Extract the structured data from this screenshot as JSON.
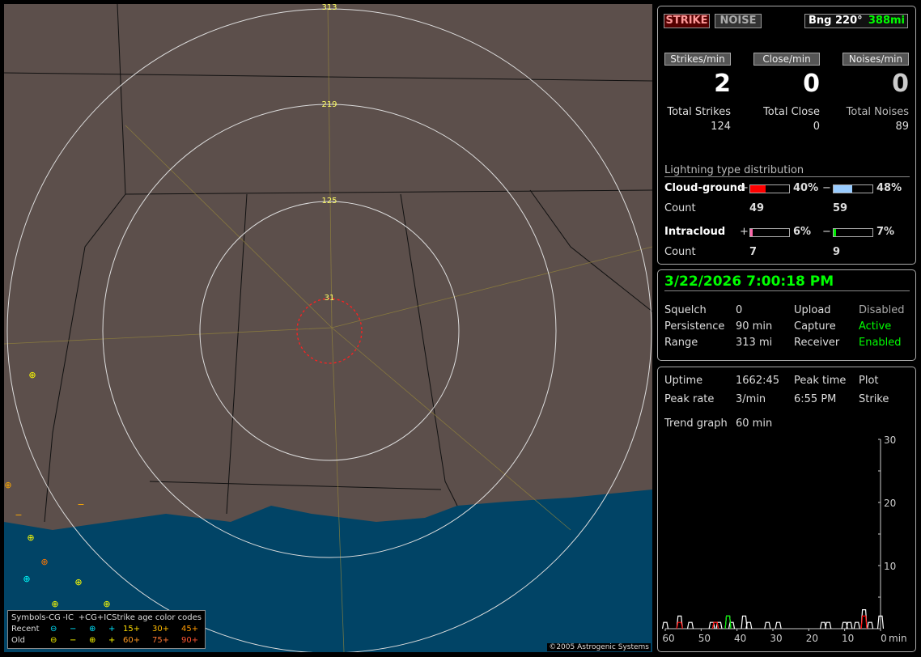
{
  "map": {
    "range_labels": [
      "313",
      "219",
      "125",
      "31"
    ],
    "legend": {
      "header": [
        "Symbols",
        "-CG",
        "-IC",
        "+CG",
        "+IC",
        "Strike age color codes"
      ],
      "recent_label": "Recent",
      "old_label": "Old",
      "recent_symbols": [
        "⊖",
        "−",
        "⊕",
        "+"
      ],
      "old_symbols": [
        "⊖",
        "−",
        "⊕",
        "+"
      ],
      "recent_ages": [
        "15+",
        "30+",
        "45+"
      ],
      "old_ages": [
        "60+",
        "75+",
        "90+"
      ]
    },
    "copyright": "©2005 Astrogenic Systems"
  },
  "top": {
    "strike_label": "STRIKE",
    "noise_label": "NOISE",
    "bearing": "Bng 220°",
    "distance": "388mi"
  },
  "rates": [
    {
      "label": "Strikes/min",
      "value": "2",
      "total_label": "Total Strikes",
      "total": "124"
    },
    {
      "label": "Close/min",
      "value": "0",
      "total_label": "Total Close",
      "total": "0"
    },
    {
      "label": "Noises/min",
      "value": "0",
      "total_label": "Total Noises",
      "total": "89"
    }
  ],
  "distribution": {
    "title": "Lightning type distribution",
    "count_label": "Count",
    "cg": {
      "label": "Cloud-ground",
      "pos_sign": "+",
      "neg_sign": "−",
      "pos_pct": "40%",
      "neg_pct": "48%",
      "pos_count": "49",
      "neg_count": "59",
      "pos_fill": 40,
      "neg_fill": 48,
      "pos_color": "#ff0000",
      "neg_color": "#99ccff"
    },
    "ic": {
      "label": "Intracloud",
      "pos_sign": "+",
      "neg_sign": "−",
      "pos_pct": "6%",
      "neg_pct": "7%",
      "pos_count": "7",
      "neg_count": "9",
      "pos_fill": 6,
      "neg_fill": 7,
      "pos_color": "#ff66aa",
      "neg_color": "#00ee00"
    }
  },
  "status": {
    "datetime": "3/22/2026 7:00:18 PM",
    "squelch_label": "Squelch",
    "squelch": "0",
    "persistence_label": "Persistence",
    "persistence": "90 min",
    "range_label": "Range",
    "range": "313 mi",
    "upload_label": "Upload",
    "upload": "Disabled",
    "capture_label": "Capture",
    "capture": "Active",
    "receiver_label": "Receiver",
    "receiver": "Enabled"
  },
  "stats": {
    "uptime_label": "Uptime",
    "uptime": "1662:45",
    "peak_time_label": "Peak time",
    "peak_time": "6:55 PM",
    "plot_label": "Plot",
    "plot": "Strike",
    "peak_rate_label": "Peak rate",
    "peak_rate": "3/min",
    "trend_label": "Trend graph",
    "trend": "60 min"
  },
  "chart_data": {
    "type": "line",
    "xlabel": "min",
    "x_ticks": [
      "60",
      "50",
      "40",
      "30",
      "20",
      "10",
      "0"
    ],
    "y_ticks": [
      "10",
      "20",
      "30"
    ],
    "xlim": [
      60,
      0
    ],
    "ylim": [
      0,
      30
    ],
    "series": [
      {
        "color": "#ffffff",
        "points": [
          [
            60,
            1
          ],
          [
            56,
            2
          ],
          [
            53,
            1
          ],
          [
            47,
            1
          ],
          [
            46,
            1
          ],
          [
            45,
            1
          ],
          [
            42.5,
            2
          ],
          [
            41.5,
            1
          ],
          [
            38,
            2
          ],
          [
            36.7,
            1
          ],
          [
            31.5,
            1
          ],
          [
            28.5,
            1
          ],
          [
            16,
            1
          ],
          [
            14.6,
            1
          ],
          [
            10,
            1
          ],
          [
            8.7,
            1
          ],
          [
            6.6,
            1
          ],
          [
            4.6,
            3
          ],
          [
            2.9,
            1
          ],
          [
            0,
            2
          ]
        ]
      },
      {
        "color": "#ff0000",
        "points": [
          [
            56,
            1
          ],
          [
            46,
            1
          ],
          [
            4.6,
            2
          ]
        ]
      },
      {
        "color": "#00ee00",
        "points": [
          [
            42.5,
            2
          ]
        ]
      }
    ]
  }
}
